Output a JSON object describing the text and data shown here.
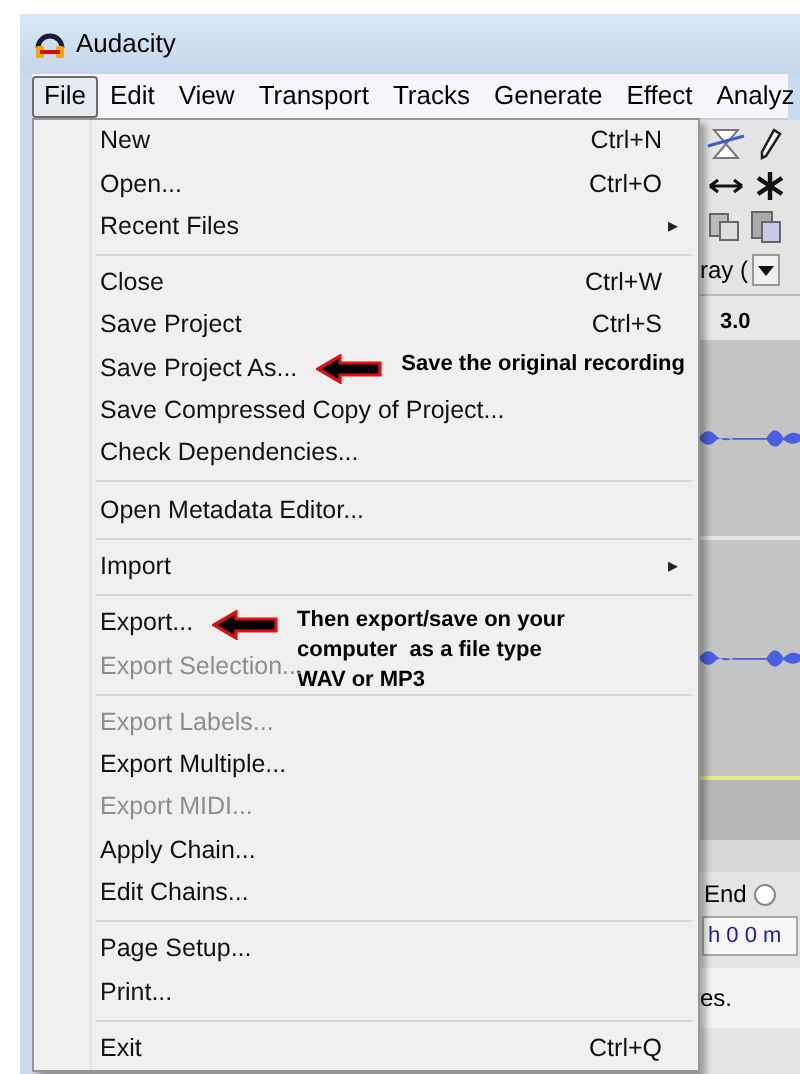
{
  "window": {
    "title": "Audacity"
  },
  "menu_bar": [
    {
      "label": "File",
      "selected": true
    },
    {
      "label": "Edit",
      "selected": false
    },
    {
      "label": "View",
      "selected": false
    },
    {
      "label": "Transport",
      "selected": false
    },
    {
      "label": "Tracks",
      "selected": false
    },
    {
      "label": "Generate",
      "selected": false
    },
    {
      "label": "Effect",
      "selected": false
    },
    {
      "label": "Analyz",
      "selected": false
    }
  ],
  "file_menu": [
    [
      {
        "label": "New",
        "shortcut": "Ctrl+N",
        "disabled": false
      },
      {
        "label": "Open...",
        "shortcut": "Ctrl+O",
        "disabled": false
      },
      {
        "label": "Recent Files",
        "submenu_arrow": "▸",
        "disabled": false
      }
    ],
    [
      {
        "label": "Close",
        "shortcut": "Ctrl+W",
        "disabled": false
      },
      {
        "label": "Save Project",
        "shortcut": "Ctrl+S",
        "disabled": false
      },
      {
        "label": "Save Project As...",
        "disabled": false,
        "annotation": "Save the original recording"
      },
      {
        "label": "Save Compressed Copy of Project...",
        "disabled": false
      },
      {
        "label": "Check Dependencies...",
        "disabled": false
      }
    ],
    [
      {
        "label": "Open Metadata Editor...",
        "disabled": false
      }
    ],
    [
      {
        "label": "Import",
        "submenu_arrow": "▸",
        "disabled": false
      }
    ],
    [
      {
        "label": "Export...",
        "disabled": false,
        "annotation": "Then export/save on your computer  as a file type WAV or MP3"
      },
      {
        "label": "Export Selection...",
        "disabled": true
      }
    ],
    [
      {
        "label": "Export Labels...",
        "disabled": true
      },
      {
        "label": "Export Multiple...",
        "disabled": false
      },
      {
        "label": "Export MIDI...",
        "disabled": true
      },
      {
        "label": "Apply Chain...",
        "disabled": false
      },
      {
        "label": "Edit Chains...",
        "disabled": false
      }
    ],
    [
      {
        "label": "Page Setup...",
        "disabled": false
      },
      {
        "label": "Print...",
        "disabled": false
      }
    ],
    [
      {
        "label": "Exit",
        "shortcut": "Ctrl+Q",
        "disabled": false
      }
    ]
  ],
  "background": {
    "dropdown_fragment": "ray (",
    "ruler_label": "3.0",
    "radio_fragment": "End",
    "radio_selected": false,
    "time_fragment": "h 0 0 m",
    "status_fragment": "es."
  }
}
